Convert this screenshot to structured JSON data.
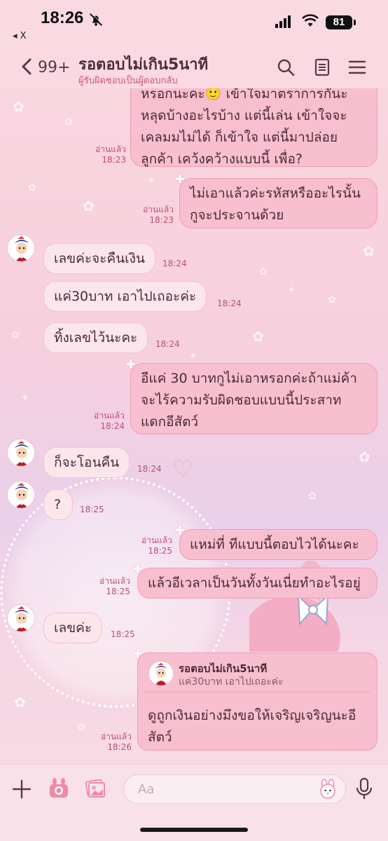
{
  "status_bar": {
    "time": "18:26",
    "back_app": "◂ X",
    "battery": "81"
  },
  "header": {
    "unread_count": "99+",
    "title": "รอตอบไม่เกิน5นาที",
    "subtitle": "ผู้รับผิดชอบเป็นผู้ตอบกลับ"
  },
  "messages": {
    "m1": {
      "lines": [
        "หรอกนะคะ🙂 เข้าใจมาตราการกันะ",
        "หลุดบ้างอะไรบ้าง แต่นี้เล่น เข้าใจจะ",
        "เคลมมไม่ได้ ก็เข้าใจ แต่นี้มาปล่อย",
        "ลูกค้า เคว้งคว้างแบบนี้ เพื่อ?"
      ],
      "read": "อ่านแล้ว",
      "time": "18:23"
    },
    "m2": {
      "lines": [
        "ไม่เอาแล้วค่ะรหัสหรืออะไรนั้น",
        "กูจะประจานด้วย"
      ],
      "read": "อ่านแล้ว",
      "time": "18:23"
    },
    "m3": {
      "text": "เลขค่ะจะคืนเงิน",
      "time": "18:24"
    },
    "m4": {
      "text": "แค่30บาท เอาไปเถอะค่ะ",
      "time": "18:24"
    },
    "m5": {
      "text": "ทิ้งเลขไว้นะคะ",
      "time": "18:24"
    },
    "m6": {
      "lines": [
        "อีแค่ 30 บาทกูไม่เอาหรอกค่ะถ้าแม่ค้า",
        "จะไร้ความรับผิดชอบแบบนี้ประสาท",
        "แดกอีสัตว์"
      ],
      "read": "อ่านแล้ว",
      "time": "18:24"
    },
    "m7": {
      "text": "ก็จะโอนคืน",
      "time": "18:24"
    },
    "m8": {
      "text": "?",
      "time": "18:25"
    },
    "m9": {
      "text": "แหม่ที่ ทีแบบนี้ตอบไวได้นะคะ",
      "read": "อ่านแล้ว",
      "time": "18:25"
    },
    "m10": {
      "text": "แล้วอีเวลาเป็นวันทั้งวันเนี่ยทำอะไรอยู่",
      "read": "อ่านแล้ว",
      "time": "18:25"
    },
    "m11": {
      "text": "เลขค่ะ",
      "time": "18:25"
    },
    "m12": {
      "quote_name": "รอตอบไม่เกิน5นาที",
      "quote_text": "แค่30บาท เอาไปเถอะค่ะ",
      "lines": [
        "ดูถูกเงินอย่างมึงขอให้เจริญเจริญนะอี",
        "สัตว์"
      ],
      "read": "อ่านแล้ว",
      "time": "18:26"
    }
  },
  "input_bar": {
    "placeholder": "Aa"
  },
  "colors": {
    "outgoing_bubble": "#f7bfd0",
    "incoming_bubble": "#fbe6ec",
    "read_receipt": "#c14d72",
    "header_bg": "#f9d9e2"
  }
}
